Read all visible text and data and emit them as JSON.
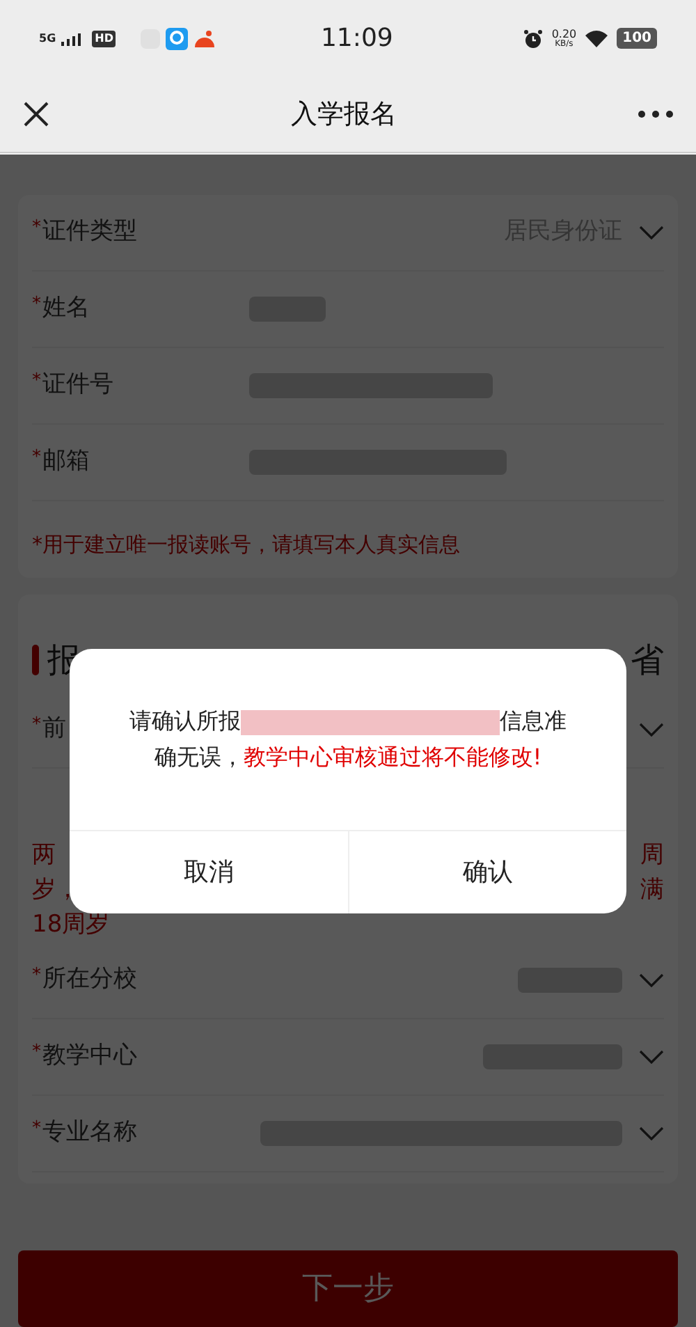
{
  "status_bar": {
    "network": "5G",
    "hd": "HD",
    "time": "11:09",
    "speed_value": "0.20",
    "speed_unit": "KB/s",
    "battery": "100"
  },
  "header": {
    "title": "入学报名"
  },
  "personal_card": {
    "rows": [
      {
        "label": "证件类型",
        "required_mark": "*",
        "value": "居民身份证",
        "kind": "select"
      },
      {
        "label": "姓名",
        "required_mark": "*",
        "kind": "redacted"
      },
      {
        "label": "证件号",
        "required_mark": "*",
        "kind": "redacted"
      },
      {
        "label": "邮箱",
        "required_mark": "*",
        "kind": "redacted"
      }
    ],
    "note": "*用于建立唯一报读账号，请填写本人真实信息"
  },
  "intent_card": {
    "title": "报",
    "province": "省",
    "rows": [
      {
        "label": "前",
        "required_mark": "*",
        "kind": "select"
      }
    ],
    "note_left": [
      "两",
      "岁，",
      "18周岁"
    ],
    "note_right": [
      "周",
      "满"
    ],
    "rows_after": [
      {
        "label": "所在分校",
        "required_mark": "*",
        "kind": "select"
      },
      {
        "label": "教学中心",
        "required_mark": "*",
        "kind": "select"
      },
      {
        "label": "专业名称",
        "required_mark": "*",
        "kind": "select"
      }
    ]
  },
  "next_button": "下一步",
  "dialog": {
    "message_start": "请确认所报",
    "message_mid": "信息准确无误，",
    "message_warning": "教学中心审核通过将不能修改!",
    "buttons": [
      "取消",
      "确认"
    ]
  }
}
